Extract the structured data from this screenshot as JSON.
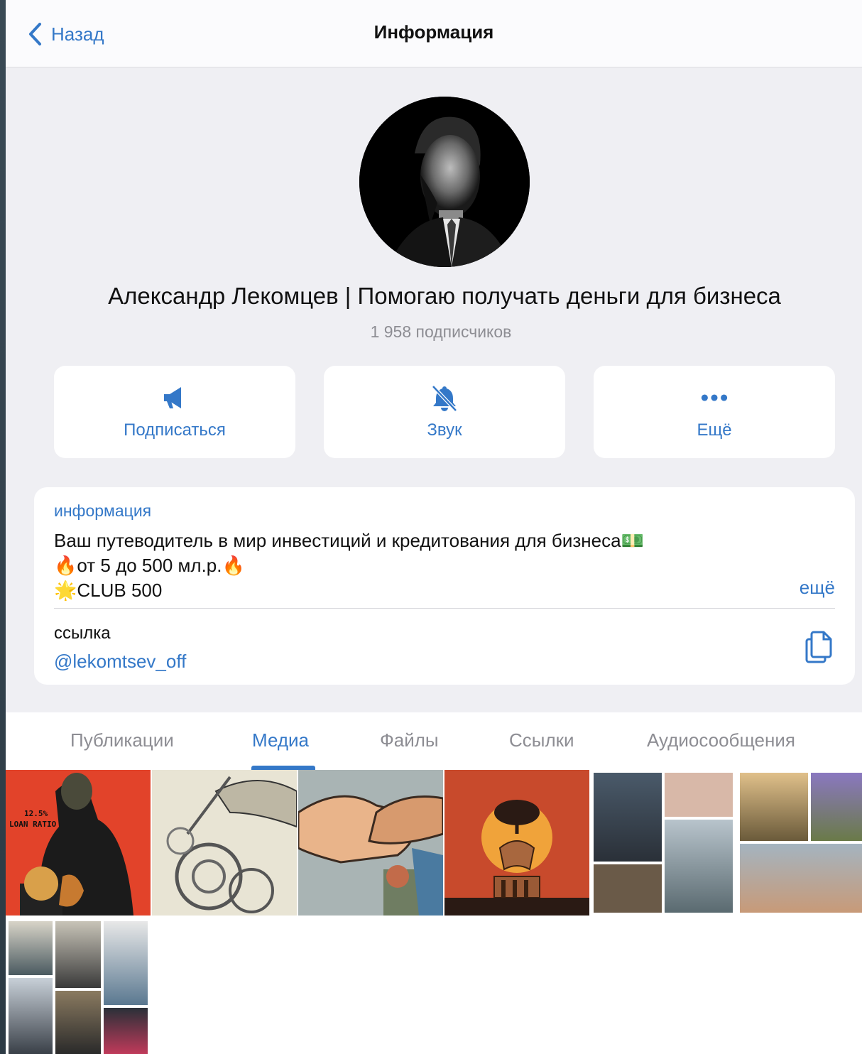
{
  "header": {
    "back_label": "Назад",
    "title": "Информация"
  },
  "profile": {
    "name": "Александр Лекомцев | Помогаю получать деньги для бизнеса",
    "subscribers": "1 958 подписчиков"
  },
  "actions": [
    {
      "label": "Подписаться",
      "icon": "megaphone-icon"
    },
    {
      "label": "Звук",
      "icon": "bell-slash-icon"
    },
    {
      "label": "Ещё",
      "icon": "ellipsis-icon"
    }
  ],
  "info": {
    "label": "информация",
    "line1": "Ваш путеводитель в мир инвестиций и кредитования для бизнеса",
    "line1_emoji": "💵",
    "line2": "от 5 до 500 мл.р.",
    "line2_emoji": "🔥",
    "line3": "CLUB 500",
    "line3_emoji": "🌟",
    "more": "ещё",
    "link_label": "ссылка",
    "link_value": "@lekomtsev_off"
  },
  "tabs": [
    {
      "label": "Публикации",
      "active": false
    },
    {
      "label": "Медиа",
      "active": true
    },
    {
      "label": "Файлы",
      "active": false
    },
    {
      "label": "Ссылки",
      "active": false
    },
    {
      "label": "Аудиосообщения",
      "active": false
    }
  ],
  "media": {
    "tile1_text_1": "12.5%",
    "tile1_text_2": "LOAN RATIO"
  },
  "colors": {
    "accent": "#3478c8",
    "background": "#efeff3",
    "card": "#ffffff",
    "secondary_text": "#8d8d93"
  }
}
